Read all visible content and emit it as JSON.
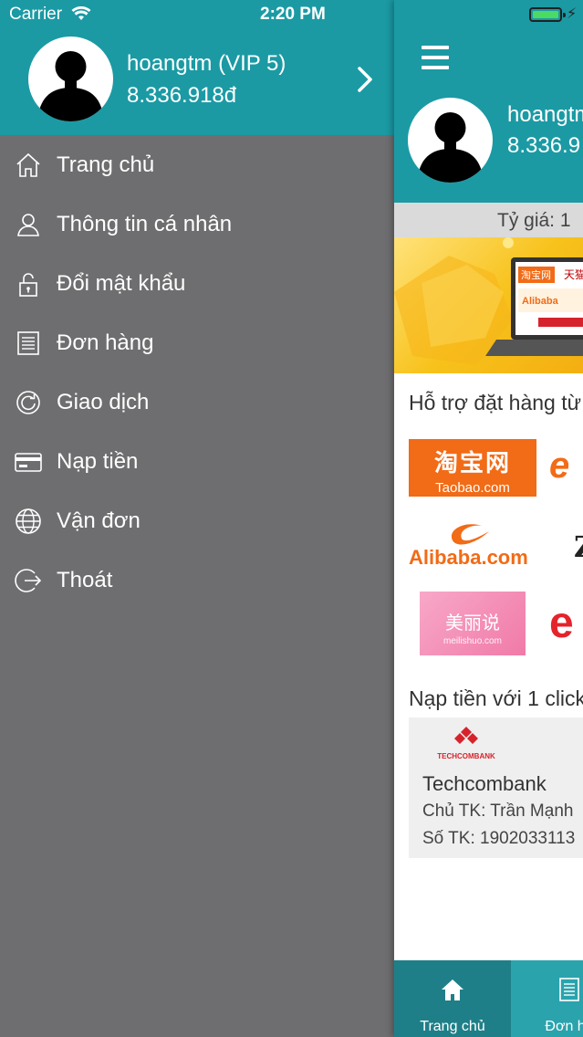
{
  "status_bar": {
    "carrier": "Carrier",
    "time": "2:20 PM"
  },
  "user": {
    "name": "hoangtm (VIP 5)",
    "balance": "8.336.918đ"
  },
  "menu": {
    "items": [
      {
        "label": "Trang chủ",
        "icon": "home-icon"
      },
      {
        "label": "Thông tin cá nhân",
        "icon": "person-icon"
      },
      {
        "label": "Đổi mật khẩu",
        "icon": "unlock-icon"
      },
      {
        "label": "Đơn hàng",
        "icon": "document-list-icon"
      },
      {
        "label": "Giao dịch",
        "icon": "refresh-icon"
      },
      {
        "label": "Nạp tiền",
        "icon": "credit-card-icon"
      },
      {
        "label": "Vận đơn",
        "icon": "globe-icon"
      },
      {
        "label": "Thoát",
        "icon": "logout-icon"
      }
    ]
  },
  "main": {
    "user_name": "hoangtm",
    "user_balance": "8.336.9",
    "rate_text": "Tỷ giá: 1",
    "section_platforms": "Hỗ trợ đặt hàng từ",
    "platforms": {
      "taobao_top": "淘宝网",
      "taobao_bottom": "Taobao.com",
      "alibaba": "Alibaba.com",
      "meilishuo_top": "美丽说",
      "meilishuo_bottom": "meilishuo.com"
    },
    "section_topup": "Nạp tiền với 1 click",
    "bank": {
      "logo_text": "TECHCOMBANK",
      "name": "Techcombank",
      "holder": "Chủ TK: Trần Mạnh",
      "account": "Số TK: 1902033113"
    },
    "tabs": [
      {
        "label": "Trang chủ",
        "icon": "home-icon"
      },
      {
        "label": "Đơn hà",
        "icon": "document-list-icon"
      }
    ]
  },
  "colors": {
    "teal": "#1b9aa4",
    "drawer_bg": "#6e6e70",
    "tab_active": "#1f7f88",
    "tab_bg": "#2aa3ad"
  }
}
